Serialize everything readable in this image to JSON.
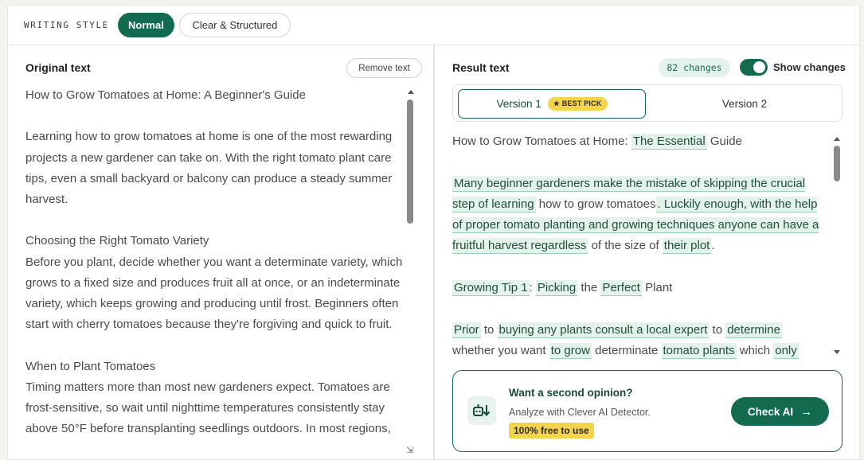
{
  "writing_style": {
    "label": "WRITING STYLE",
    "options": [
      "Normal",
      "Clear & Structured"
    ],
    "selected": "Normal"
  },
  "original": {
    "title": "Original text",
    "remove_label": "Remove text",
    "paragraphs": [
      "How to Grow Tomatoes at Home: A Beginner's Guide",
      "Learning how to grow tomatoes at home is one of the most rewarding projects a new gardener can take on. With the right tomato plant care tips, even a small backyard or balcony can produce a steady summer harvest.",
      "Choosing the Right Tomato Variety",
      "Before you plant, decide whether you want a determinate variety, which grows to a fixed size and produces fruit all at once, or an indeterminate variety, which keeps growing and producing until frost. Beginners often start with cherry tomatoes because they're forgiving and quick to fruit.",
      "When to Plant Tomatoes",
      "Timing matters more than most new gardeners expect. Tomatoes are frost-sensitive, so wait until nighttime temperatures consistently stay above 50°F before transplanting seedlings outdoors. In most regions,"
    ]
  },
  "result": {
    "title": "Result text",
    "changes_count": "82 changes",
    "show_changes_label": "Show changes",
    "show_changes_on": true,
    "versions": [
      {
        "label": "Version 1",
        "badge": "★ BEST PICK",
        "selected": true
      },
      {
        "label": "Version 2",
        "selected": false
      }
    ],
    "title_plain": "How to Grow Tomatoes at Home: ",
    "title_changed": "The Essential",
    "title_end": " Guide",
    "p1": [
      {
        "t": "Many beginner gardeners make the mistake of skipping the crucial step of learning",
        "c": true
      },
      {
        "t": " how to grow tomatoes",
        "c": false
      },
      {
        "t": ". Luckily enough, with the help of proper tomato planting and growing techniques anyone can have a fruitful harvest regardless",
        "c": true
      },
      {
        "t": " of the size of ",
        "c": false
      },
      {
        "t": "their plot",
        "c": true
      },
      {
        "t": ".",
        "c": false
      }
    ],
    "p2": [
      {
        "t": "Growing Tip 1",
        "c": true
      },
      {
        "t": ": ",
        "c": false
      },
      {
        "t": "Picking",
        "c": true
      },
      {
        "t": " the ",
        "c": false
      },
      {
        "t": "Perfect",
        "c": true
      },
      {
        "t": " Plant",
        "c": false
      }
    ],
    "p3": [
      {
        "t": "Prior",
        "c": true
      },
      {
        "t": " to ",
        "c": false
      },
      {
        "t": "buying any plants consult a local expert",
        "c": true
      },
      {
        "t": " to ",
        "c": false
      },
      {
        "t": "determine",
        "c": true
      },
      {
        "t": " whether you want ",
        "c": false
      },
      {
        "t": "to grow",
        "c": true
      },
      {
        "t": " determinate ",
        "c": false
      },
      {
        "t": "tomato plants",
        "c": true
      },
      {
        "t": " which ",
        "c": false
      },
      {
        "t": "only",
        "c": true
      }
    ]
  },
  "promo": {
    "title": "Want a second opinion?",
    "subtitle": "Analyze with Clever AI Detector.",
    "free_label": "100% free to use",
    "button_label": "Check AI",
    "button_icon": "arrow-right-icon",
    "icon": "ai-detector-icon",
    "accent": "#126b4e",
    "highlight_bg": "#e3f2ea",
    "badge_yellow": "#f4d44a"
  }
}
